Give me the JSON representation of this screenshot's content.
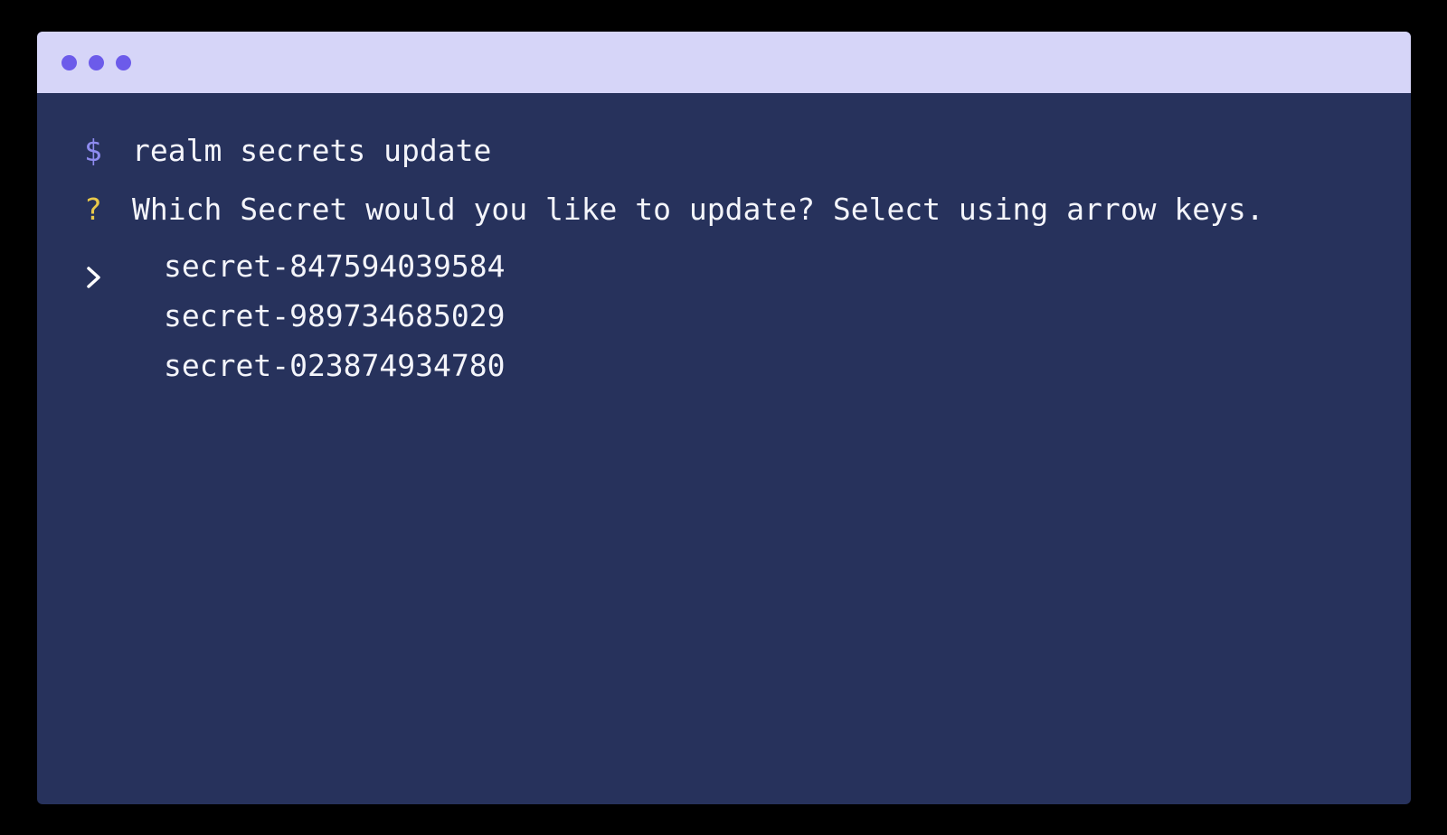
{
  "window": {
    "titlebar_color": "#d6d5f8",
    "dot_color": "#6c5bea",
    "background": "#27325c"
  },
  "terminal": {
    "prompt_symbol": "$",
    "command": "realm secrets update",
    "question_symbol": "?",
    "question": "Which Secret would you like to update? Select using arrow keys.",
    "selector_icon": "chevron-right-icon",
    "options": [
      "secret-847594039584",
      "secret-989734685029",
      "secret-023874934780"
    ],
    "selected_index": 0
  }
}
